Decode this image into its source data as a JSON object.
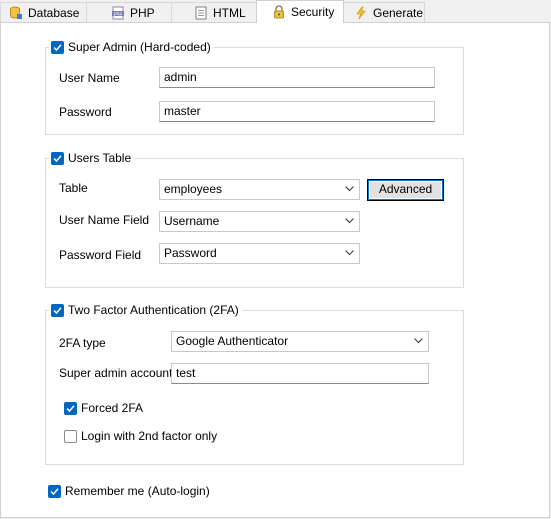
{
  "tabs": [
    {
      "label": "Database",
      "icon": "database-icon"
    },
    {
      "label": "PHP",
      "icon": "php-file-icon"
    },
    {
      "label": "HTML",
      "icon": "html-file-icon"
    },
    {
      "label": "Security",
      "icon": "lock-icon",
      "active": true
    },
    {
      "label": "Generate",
      "icon": "lightning-icon"
    }
  ],
  "super_admin": {
    "legend": "Super Admin (Hard-coded)",
    "checked": true,
    "username_label": "User Name",
    "username_value": "admin",
    "password_label": "Password",
    "password_value": "master"
  },
  "users_table": {
    "legend": "Users Table",
    "checked": true,
    "table_label": "Table",
    "table_value": "employees",
    "advanced_button": "Advanced",
    "username_field_label": "User Name Field",
    "username_field_value": "Username",
    "password_field_label": "Password Field",
    "password_field_value": "Password"
  },
  "two_factor": {
    "legend": "Two Factor Authentication (2FA)",
    "checked": true,
    "type_label": "2FA type",
    "type_value": "Google Authenticator",
    "super_admin_account_label": "Super admin account",
    "super_admin_account_value": "test",
    "forced_label": "Forced 2FA",
    "forced_checked": true,
    "login_2nd_only_label": "Login with 2nd factor only",
    "login_2nd_only_checked": false
  },
  "remember_me": {
    "label": "Remember me (Auto-login)",
    "checked": true
  },
  "colors": {
    "accent": "#0067c0",
    "button_focus_border": "#0078d7"
  }
}
